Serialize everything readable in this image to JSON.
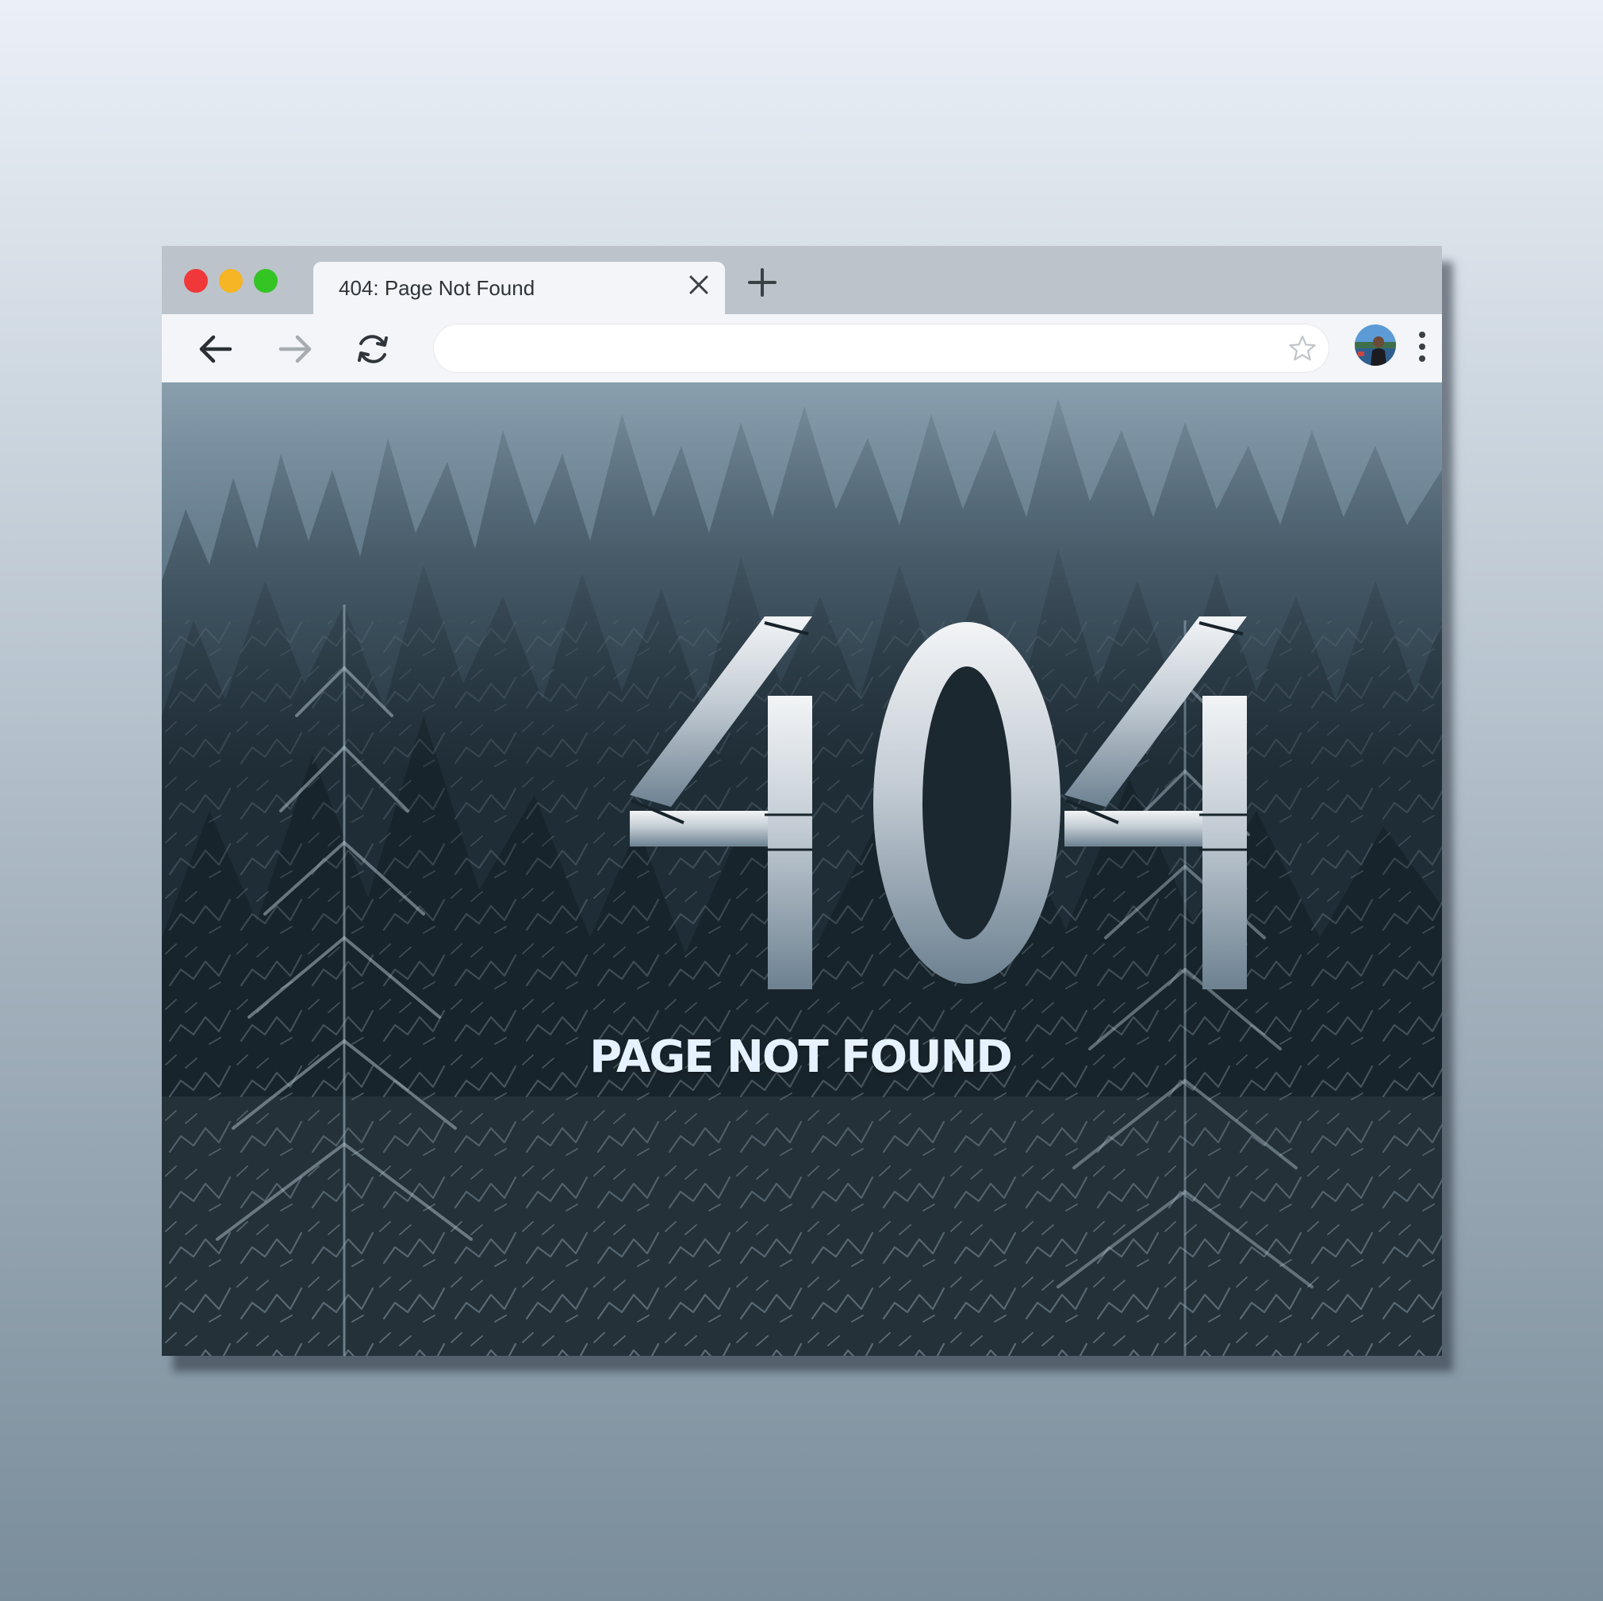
{
  "browser": {
    "tab": {
      "title": "404: Page Not Found"
    },
    "address_bar": {
      "value": ""
    }
  },
  "icons": {
    "window_controls": [
      "close-dot-icon",
      "minimize-dot-icon",
      "maximize-dot-icon"
    ],
    "tab_close": "close-icon",
    "new_tab": "plus-icon",
    "back": "arrow-left-icon",
    "forward": "arrow-right-icon",
    "reload": "reload-icon",
    "bookmark": "star-icon",
    "profile": "avatar",
    "menu": "vertical-dots-icon"
  },
  "page": {
    "error_code": "404",
    "heading": "PAGE NOT FOUND"
  },
  "colors": {
    "close_dot": "#f0383a",
    "minimize_dot": "#f5b524",
    "maximize_dot": "#34c424",
    "tab_strip": "#bcc3ca",
    "toolbar": "#f3f5f8",
    "heading_text": "#e6f2ff",
    "digits_top": "#f2f4f6",
    "digits_bottom": "#6d8191"
  }
}
